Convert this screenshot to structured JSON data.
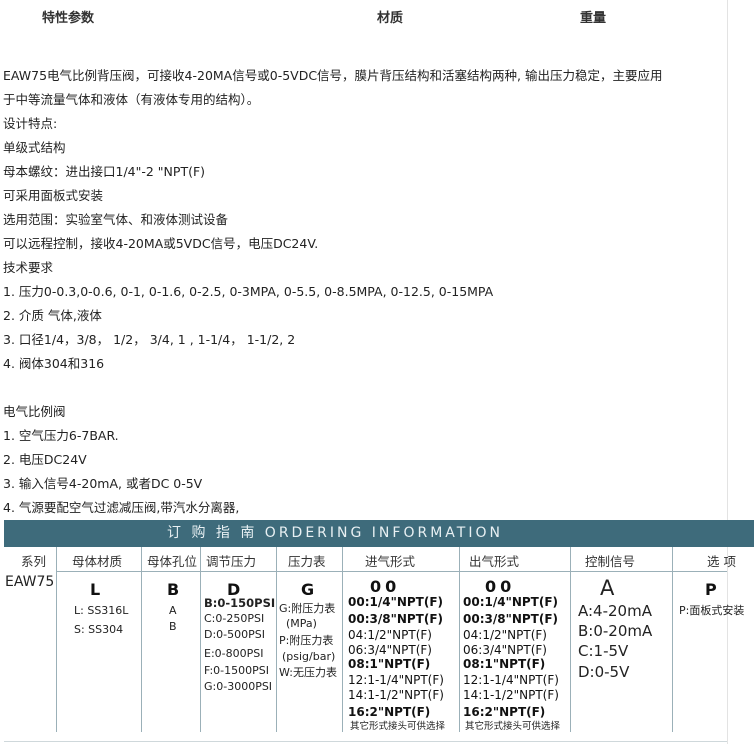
{
  "header": {
    "col1": "特性参数",
    "col2": "材质",
    "col3": "重量"
  },
  "body_lines": [
    "EAW75电气比例背压阀，可接收4-20MA信号或0-5VDC信号，膜片背压结构和活塞结构两种, 输出压力稳定，主要应用",
    "于中等流量气体和液体（有液体专用的结构）。",
    "设计特点:",
    "单级式结构",
    "母本螺纹：进出接口1/4\"-2 \"NPT(F)",
    "可采用面板式安装",
    "选用范围：实验室气体、和液体测试设备",
    "可以远程控制，接收4-20MA或5VDC信号，电压DC24V.",
    "技术要求",
    "1. 压力0-0.3,0-0.6, 0-1, 0-1.6, 0-2.5, 0-3MPA, 0-5.5, 0-8.5MPA, 0-12.5, 0-15MPA",
    "2. 介质 气体,液体",
    "3. 口径1/4，3/8，  1/2，  3/4, 1 , 1-1/4，  1-1/2, 2",
    "4. 阀体304和316",
    "",
    "电气比例阀",
    "1. 空气压力6-7BAR.",
    "2. 电压DC24V",
    "3. 输入信号4-20mA, 或者DC 0-5V",
    "4. 气源要配空气过滤减压阀,带汽水分离器,"
  ],
  "ordering": {
    "title": "订 购 指 南     ORDERING   INFORMATION",
    "headers": [
      "系列",
      "母体材质",
      "母体孔位",
      "调节压力",
      "压力表",
      "进气形式",
      "出气形式",
      "控制信号",
      "选 项"
    ],
    "series": "EAW75",
    "material": {
      "code": "L",
      "options": [
        "L: SS316L",
        "S:  SS304"
      ]
    },
    "port": {
      "code": "B",
      "options": [
        "A",
        "B"
      ]
    },
    "pressure": {
      "code": "D",
      "options": [
        "B:0-150PSI",
        "C:0-250PSI",
        "D:0-500PSI",
        "E:0-800PSI",
        "F:0-1500PSI",
        "G:0-3000PSI"
      ]
    },
    "gauge": {
      "code": "G",
      "options": [
        "G:附压力表",
        "(MPa)",
        "P:附压力表",
        "(psig/bar)",
        "W:无压力表"
      ]
    },
    "inlet": {
      "code": "00",
      "options": [
        "00:1/4\"NPT(F)",
        "00:3/8\"NPT(F)",
        "04:1/2\"NPT(F)",
        "06:3/4\"NPT(F)",
        "08:1\"NPT(F)",
        "12:1-1/4\"NPT(F)",
        "14:1-1/2\"NPT(F)",
        "16:2\"NPT(F)"
      ],
      "note": "其它形式接头可供选择"
    },
    "outlet": {
      "code": "00",
      "options": [
        "00:1/4\"NPT(F)",
        "00:3/8\"NPT(F)",
        "04:1/2\"NPT(F)",
        "06:3/4\"NPT(F)",
        "08:1\"NPT(F)",
        "12:1-1/4\"NPT(F)",
        "14:1-1/2\"NPT(F)",
        "16:2\"NPT(F)"
      ],
      "note": "其它形式接头可供选择"
    },
    "signal": {
      "code": "A",
      "options": [
        "A:4-20mA",
        "B:0-20mA",
        "C:1-5V",
        "D:0-5V"
      ]
    },
    "option": {
      "code": "P",
      "options": [
        "P:面板式安装"
      ]
    }
  }
}
